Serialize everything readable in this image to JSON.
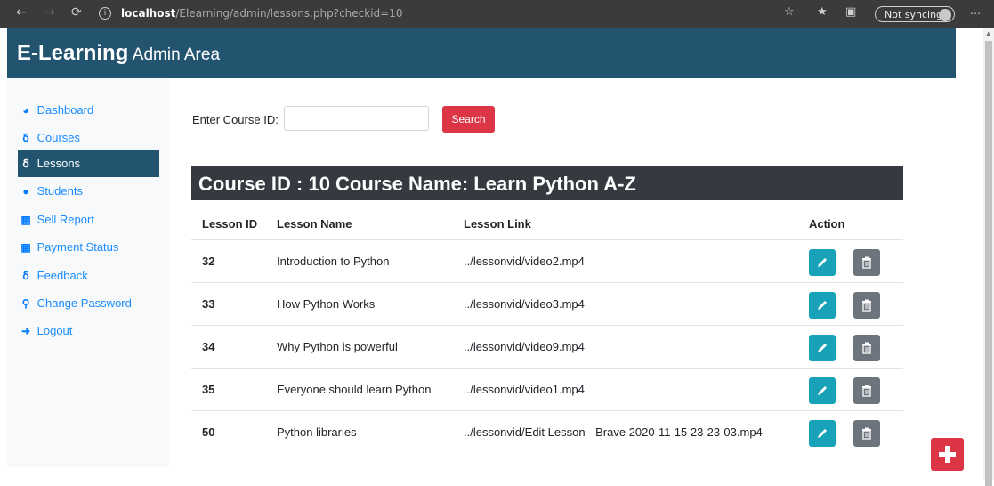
{
  "browser": {
    "host": "localhost",
    "path": "/Elearning/admin/lessons.php?checkid=10",
    "sync_label": "Not syncing"
  },
  "header": {
    "brand_bold": "E-Learning",
    "brand_rest": "Admin Area"
  },
  "sidebar": {
    "items": [
      {
        "label": "Dashboard",
        "icon": "dashboard-icon"
      },
      {
        "label": "Courses",
        "icon": "graduation-icon"
      },
      {
        "label": "Lessons",
        "icon": "graduation-icon",
        "active": true
      },
      {
        "label": "Students",
        "icon": "users-icon"
      },
      {
        "label": "Sell Report",
        "icon": "table-icon"
      },
      {
        "label": "Payment Status",
        "icon": "table-icon"
      },
      {
        "label": "Feedback",
        "icon": "graduation-icon"
      },
      {
        "label": "Change Password",
        "icon": "key-icon"
      },
      {
        "label": "Logout",
        "icon": "sign-out-icon"
      }
    ]
  },
  "search": {
    "label": "Enter Course ID:",
    "value": "",
    "button": "Search"
  },
  "course": {
    "title": "Course ID : 10 Course Name: Learn Python A-Z"
  },
  "table": {
    "headers": [
      "Lesson ID",
      "Lesson Name",
      "Lesson Link",
      "Action"
    ],
    "rows": [
      {
        "id": "32",
        "name": "Introduction to Python",
        "link": "../lessonvid/video2.mp4"
      },
      {
        "id": "33",
        "name": "How Python Works",
        "link": "../lessonvid/video3.mp4"
      },
      {
        "id": "34",
        "name": "Why Python is powerful",
        "link": "../lessonvid/video9.mp4"
      },
      {
        "id": "35",
        "name": "Everyone should learn Python",
        "link": "../lessonvid/video1.mp4"
      },
      {
        "id": "50",
        "name": "Python libraries",
        "link": "../lessonvid/Edit Lesson - Brave 2020-11-15 23-23-03.mp4"
      }
    ]
  },
  "colors": {
    "header": "#225470",
    "danger": "#dc3545",
    "info": "#17a2b8",
    "secondary": "#6c757d",
    "dark": "#343a40"
  }
}
